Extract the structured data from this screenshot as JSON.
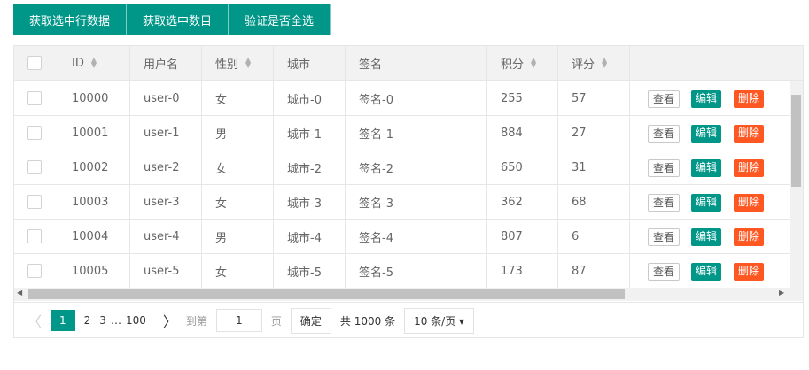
{
  "toolbar": [
    "获取选中行数据",
    "获取选中数目",
    "验证是否全选"
  ],
  "columns": [
    "ID",
    "用户名",
    "性别",
    "城市",
    "签名",
    "积分",
    "评分"
  ],
  "rows": [
    [
      "10000",
      "user-0",
      "女",
      "城市-0",
      "签名-0",
      "255",
      "57"
    ],
    [
      "10001",
      "user-1",
      "男",
      "城市-1",
      "签名-1",
      "884",
      "27"
    ],
    [
      "10002",
      "user-2",
      "女",
      "城市-2",
      "签名-2",
      "650",
      "31"
    ],
    [
      "10003",
      "user-3",
      "女",
      "城市-3",
      "签名-3",
      "362",
      "68"
    ],
    [
      "10004",
      "user-4",
      "男",
      "城市-4",
      "签名-4",
      "807",
      "6"
    ],
    [
      "10005",
      "user-5",
      "女",
      "城市-5",
      "签名-5",
      "173",
      "87"
    ]
  ],
  "actions": {
    "view": "查看",
    "edit": "编辑",
    "del": "删除"
  },
  "pager": {
    "prev": "〈",
    "pages": [
      "1",
      "2",
      "3"
    ],
    "ellipsis": "…",
    "last": "100",
    "next": "〉",
    "goto": "到第",
    "page_value": "1",
    "page_unit": "页",
    "confirm": "确定",
    "total": "共 1000 条",
    "limit": "10 条/页 ▾"
  }
}
